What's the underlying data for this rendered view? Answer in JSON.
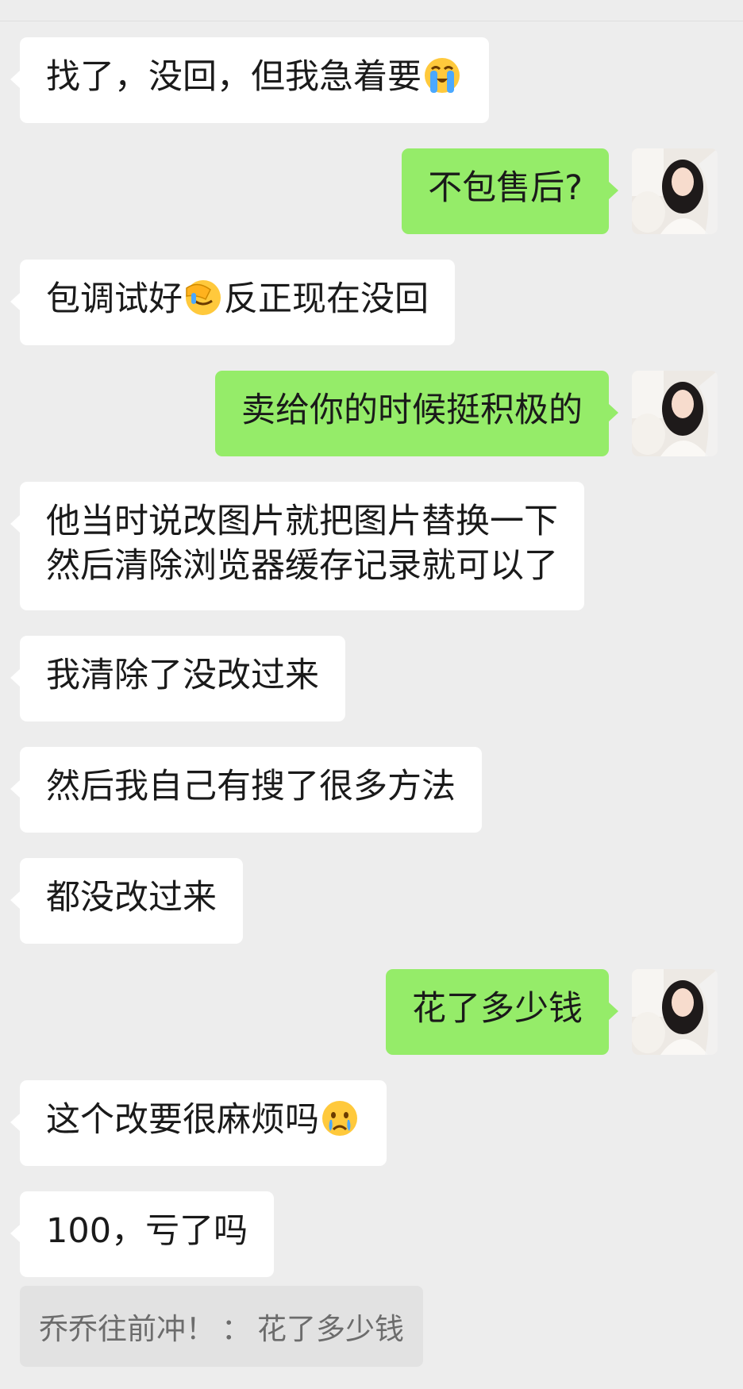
{
  "chat": {
    "messages": [
      {
        "side": "left",
        "text": "找了，没回，但我急着要",
        "emoji": "loudly-crying"
      },
      {
        "side": "right",
        "text": "不包售后?"
      },
      {
        "side": "left",
        "text": "包调试好",
        "emoji": "face-palm",
        "text_after": "反正现在没回"
      },
      {
        "side": "right",
        "text": "卖给你的时候挺积极的"
      },
      {
        "side": "left",
        "lines": [
          "他当时说改图片就把图片替换一下",
          "然后清除浏览器缓存记录就可以了"
        ]
      },
      {
        "side": "left",
        "text": "我清除了没改过来"
      },
      {
        "side": "left",
        "text": "然后我自己有搜了很多方法"
      },
      {
        "side": "left",
        "text": "都没改过来"
      },
      {
        "side": "right",
        "text": "花了多少钱"
      },
      {
        "side": "left",
        "text": "这个改要很麻烦吗",
        "emoji": "crying"
      },
      {
        "side": "left",
        "text": "100，亏了吗"
      }
    ],
    "quote": {
      "sender": "乔乔往前冲！",
      "separator": "：",
      "text": "花了多少钱"
    }
  },
  "colors": {
    "background": "#ededed",
    "incoming_bubble": "#ffffff",
    "outgoing_bubble": "#95ec69",
    "quote_background": "#e2e2e2",
    "quote_text": "#6c6c6c"
  }
}
